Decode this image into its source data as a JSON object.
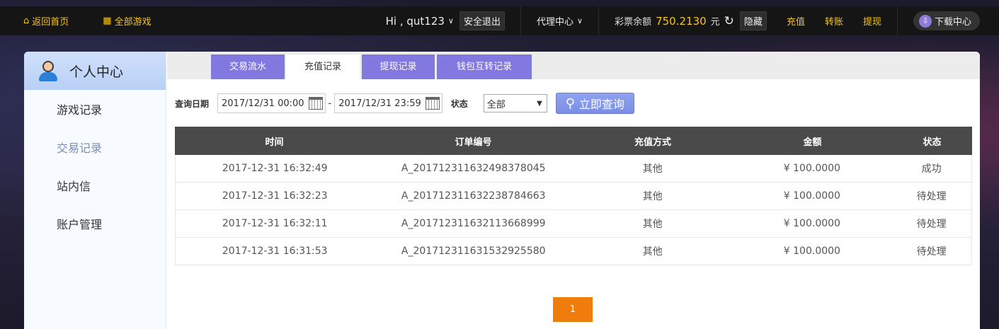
{
  "topbar": {
    "home_label": "返回首页",
    "all_games_label": "全部游戏",
    "greeting": "Hi , qut123",
    "logout_label": "安全退出",
    "agent_label": "代理中心",
    "balance_label": "彩票余额",
    "balance_value": "750.2130",
    "balance_unit": "元",
    "hide_label": "隐藏",
    "recharge_label": "充值",
    "transfer_label": "转账",
    "withdraw_label": "提现",
    "download_label": "下载中心"
  },
  "sidebar": {
    "title": "个人中心",
    "items": [
      {
        "label": "游戏记录"
      },
      {
        "label": "交易记录"
      },
      {
        "label": "站内信"
      },
      {
        "label": "账户管理"
      }
    ]
  },
  "tabs": [
    {
      "label": "交易流水"
    },
    {
      "label": "充值记录"
    },
    {
      "label": "提现记录"
    },
    {
      "label": "钱包互转记录"
    }
  ],
  "query": {
    "date_label": "查询日期",
    "start_date": "2017/12/31 00:00",
    "end_date": "2017/12/31 23:59",
    "separator": "-",
    "status_label": "状态",
    "status_value": "全部",
    "search_label": "立即查询"
  },
  "table": {
    "headers": [
      "时间",
      "订单编号",
      "充值方式",
      "金额",
      "状态"
    ],
    "rows": [
      [
        "2017-12-31 16:32:49",
        "A_201712311632498378045",
        "其他",
        "¥ 100.0000",
        "成功"
      ],
      [
        "2017-12-31 16:32:23",
        "A_201712311632238784663",
        "其他",
        "¥ 100.0000",
        "待处理"
      ],
      [
        "2017-12-31 16:32:11",
        "A_201712311632113668999",
        "其他",
        "¥ 100.0000",
        "待处理"
      ],
      [
        "2017-12-31 16:31:53",
        "A_201712311631532925580",
        "其他",
        "¥ 100.0000",
        "待处理"
      ]
    ]
  },
  "pager": {
    "current": "1"
  },
  "colors": {
    "accent": "#8178e0",
    "highlight": "#f5c518",
    "pager": "#f07d0b"
  }
}
